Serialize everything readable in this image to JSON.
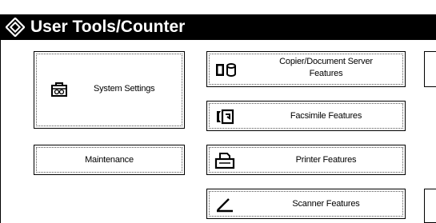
{
  "header": {
    "title": "User Tools/Counter",
    "logo_icon": "diamond-arrow-icon"
  },
  "buttons": {
    "system_settings": {
      "label": "System Settings",
      "icon": "toolbox-icon"
    },
    "maintenance": {
      "label": "Maintenance"
    },
    "copier": {
      "label_line1": "Copier/Document Server",
      "label_line2": "Features",
      "icon": "copier-document-server-icon"
    },
    "facsimile": {
      "label": "Facsimile Features",
      "icon": "facsimile-icon"
    },
    "printer": {
      "label": "Printer Features",
      "icon": "printer-icon"
    },
    "scanner": {
      "label": "Scanner Features",
      "icon": "scanner-icon"
    }
  },
  "colors": {
    "titlebar_bg": "#000000",
    "titlebar_text": "#ffffff",
    "button_border": "#000000",
    "background": "#ffffff"
  }
}
